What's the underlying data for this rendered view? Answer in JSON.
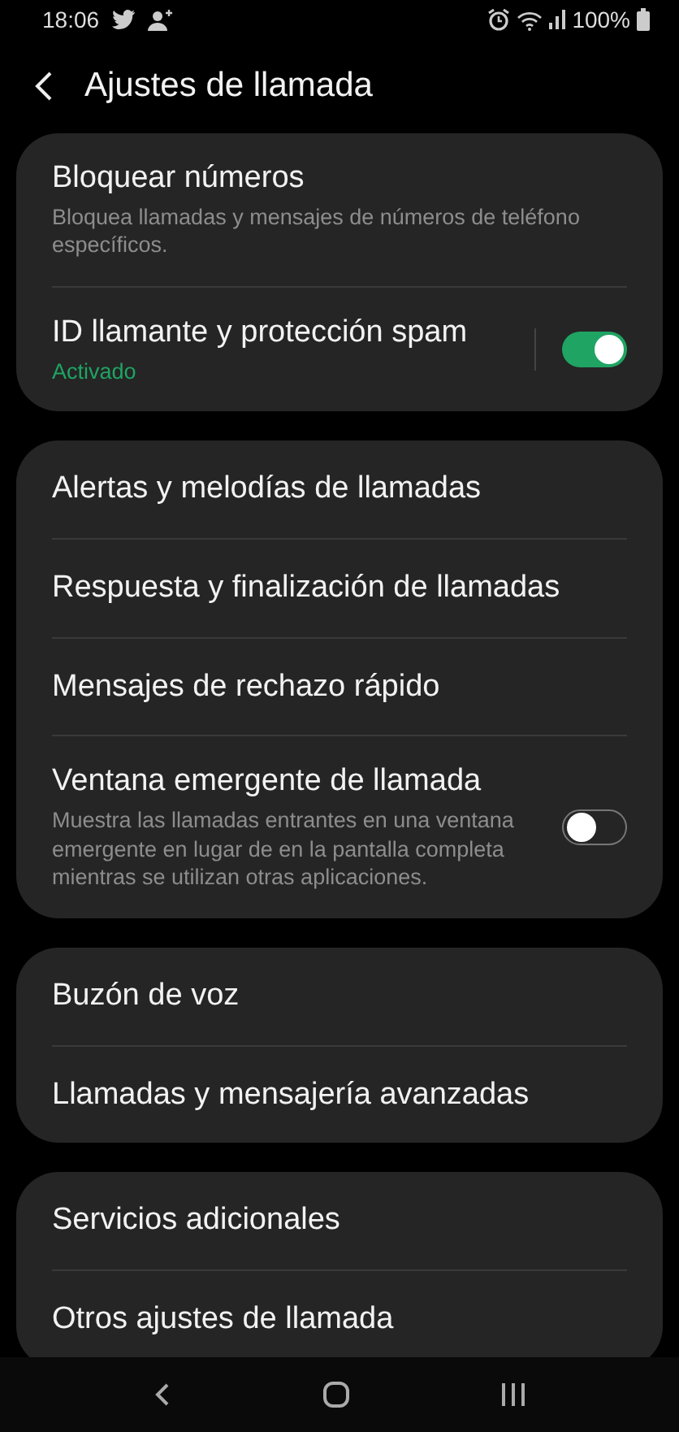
{
  "status_bar": {
    "time": "18:06",
    "battery": "100%"
  },
  "header": {
    "title": "Ajustes de llamada"
  },
  "groups": [
    {
      "items": [
        {
          "title": "Bloquear números",
          "subtitle": "Bloquea llamadas y mensajes de números de teléfono específicos.",
          "kind": "description"
        },
        {
          "title": "ID llamante y protección spam",
          "subtitle": "Activado",
          "kind": "status",
          "toggle": {
            "on": true,
            "split": true
          }
        }
      ]
    },
    {
      "items": [
        {
          "title": "Alertas y melodías de llamadas"
        },
        {
          "title": "Respuesta y finalización de llamadas"
        },
        {
          "title": "Mensajes de rechazo rápido"
        },
        {
          "title": "Ventana emergente de llamada",
          "subtitle": "Muestra las llamadas entrantes en una ventana emergente en lugar de en la pantalla completa mientras se utilizan otras aplicaciones.",
          "kind": "description",
          "toggle": {
            "on": false,
            "split": false
          }
        }
      ]
    },
    {
      "items": [
        {
          "title": "Buzón de voz"
        },
        {
          "title": "Llamadas y mensajería avanzadas"
        }
      ]
    },
    {
      "items": [
        {
          "title": "Servicios adicionales"
        },
        {
          "title": "Otros ajustes de llamada"
        }
      ]
    }
  ]
}
